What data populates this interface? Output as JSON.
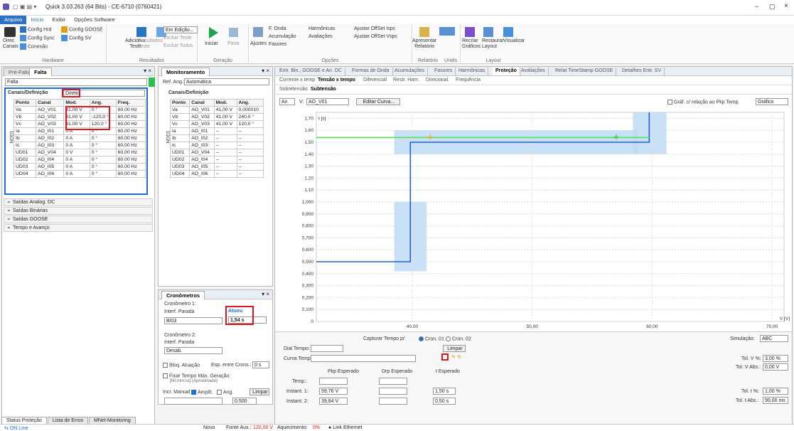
{
  "titlebar": {
    "title": "Quick 3.03.263 (64 Bits) - CE-6710 (0760421)",
    "min": "−",
    "max": "▢",
    "close": "×"
  },
  "menu": [
    "Arquivo",
    "Início",
    "Exibir",
    "Opções Software"
  ],
  "ribbon": {
    "direc": "Direc\nCanais",
    "config_hrd": "Config Hrd",
    "config_goose": "Config GOOSE",
    "config_sync": "Config Sync",
    "config_sv": "Config SV",
    "conexao": "Conexão",
    "hardware": "Hardware",
    "adicionar": "Adicionar\nTeste",
    "resultados_btn": "Resultados\nTeste",
    "em_edicao": "Em Edição...",
    "excluir_teste": "Excluir Teste",
    "excluir_todos": "Excluir Todos",
    "resultados": "Resultados",
    "iniciar": "Iniciar",
    "parar": "Parar",
    "geracao": "Geração",
    "ajustes": "Ajustes",
    "f_onda": "F. Onda",
    "acumulacao": "Acumulação",
    "fasores": "Fasores",
    "harmonicas": "Harmônicas",
    "avaliacoes": "Avaliações",
    "ajustar_offset_ispc": "Ajustar OffSet Ispc",
    "ajustar_offset_vspc": "Ajustar OffSet Vspc",
    "opcoes": "Opções",
    "apresentar": "Apresentar\nRelatório",
    "relatorio": "Relatório",
    "unids": "Unids",
    "recriar": "Recriar\nGráficos",
    "restaurar": "Restaurar\nLayout",
    "visualizar": "Visualizar",
    "layout": "Layout"
  },
  "left_panel": {
    "tabs": [
      "Pré-Falta",
      "Falta"
    ],
    "name_field": "Falta",
    "section": "Canais/Definição",
    "mode": "Direto",
    "side_label": "NOD1",
    "headers": [
      "Ponto",
      "Canal",
      "Mod.",
      "Ang.",
      "Freq."
    ],
    "rows": [
      [
        "Va",
        "AO_V01",
        "41,00 V",
        "0 °",
        "60,00 Hz"
      ],
      [
        "Vb",
        "AO_V02",
        "41,00 V",
        "-120,0 °",
        "60,00 Hz"
      ],
      [
        "Vc",
        "AO_V03",
        "41,00 V",
        "120,0 °",
        "60,00 Hz"
      ],
      [
        "Ia",
        "AO_I01",
        "0 A",
        "0 °",
        "60,00 Hz"
      ],
      [
        "Ib",
        "AO_I02",
        "0 A",
        "0 °",
        "60,00 Hz"
      ],
      [
        "Ic",
        "AO_I03",
        "0 A",
        "0 °",
        "60,00 Hz"
      ],
      [
        "UD01",
        "AO_V04",
        "0 V",
        "0 °",
        "60,00 Hz"
      ],
      [
        "UD02",
        "AO_I04",
        "0 A",
        "0 °",
        "60,00 Hz"
      ],
      [
        "UD03",
        "AO_I05",
        "0 A",
        "0 °",
        "60,00 Hz"
      ],
      [
        "UD04",
        "AO_I06",
        "0 A",
        "0 °",
        "60,00 Hz"
      ]
    ],
    "sections": [
      "Saídas Analog. DC",
      "Saídas Binárias",
      "Saídas GOOSE",
      "Tempo e Avanço"
    ]
  },
  "monitor": {
    "title": "Monitoramento",
    "ref_label": "Ref. Ang.:",
    "ref_value": "Automática",
    "section": "Canais/Definição",
    "side_label": "NOD1",
    "headers": [
      "Ponto",
      "Canal",
      "Mod.",
      "Ang."
    ],
    "rows": [
      [
        "Va",
        "AO_V01",
        "41,00 V",
        "0,000010"
      ],
      [
        "Vb",
        "AO_V02",
        "41,00 V",
        "240,0 °"
      ],
      [
        "Vc",
        "AO_V03",
        "41,00 V",
        "120,0 °"
      ],
      [
        "Ia",
        "AO_I01",
        "--",
        "--"
      ],
      [
        "Ib",
        "AO_I02",
        "--",
        "--"
      ],
      [
        "Ic",
        "AO_I03",
        "--",
        "--"
      ],
      [
        "UD01",
        "AO_V04",
        "--",
        "--"
      ],
      [
        "UD02",
        "AO_I04",
        "--",
        "--"
      ],
      [
        "UD03",
        "AO_I05",
        "--",
        "--"
      ],
      [
        "UD04",
        "AO_I06",
        "--",
        "--"
      ]
    ]
  },
  "crono": {
    "title": "Cronômetros",
    "c1": "Cronômetro 1:",
    "interf": "Interf. Parada",
    "c1_input": "BI03",
    "atuou": "Atuou",
    "time": "1,54 s",
    "c2": "Cronômetro 2:",
    "interf2": "Interf. Parada",
    "c2_input": "Desab.",
    "bloq": "Bloq. Atuação",
    "esp": "Esp. entre Crons.:",
    "esp_val": "0 s",
    "fixar": "Fixar Tempo Máx. Geração:",
    "fixar_sub": "[hh:mm:ss] (Aproximado)",
    "incr": "Incr. Manual",
    "amplit": "Amplit.",
    "ang": "Ang.",
    "limpar": "Limpar",
    "step": "0,500"
  },
  "right_tabs": [
    "Entr. Bin., GOOSE e An. DC",
    "Formas de Onda",
    "Acumulações",
    "Fasores",
    "Harmônicas",
    "Proteção",
    "Avaliações",
    "Relat TimeStamp GOOSE",
    "Detalhes Entr. SV"
  ],
  "prot_tabs": [
    "Corrente x tempo",
    "Tensão x tempo",
    "Diferencial",
    "Restr. Ham.",
    "Direcional",
    "Frequência"
  ],
  "sub_tabs": [
    "Sobretensão",
    "Subtensão"
  ],
  "chart_toolbar": {
    "an": "An",
    "v_label": "V:",
    "v_value": "AO_V01",
    "editar": "Editar Curva...",
    "grafico_chk": "Gráf. c/ relação ao Pkp Temp.",
    "grafico": "Gráfico"
  },
  "chart_data": {
    "type": "line",
    "xlabel": "V [V]",
    "ylabel": "t [s]",
    "xlim": [
      32,
      71
    ],
    "ylim": [
      0,
      1.75
    ],
    "y_ticks": [
      {
        "v": 0,
        "t": "0"
      },
      {
        "v": 0.1,
        "t": "0,100"
      },
      {
        "v": 0.2,
        "t": "0,200"
      },
      {
        "v": 0.3,
        "t": "0,300"
      },
      {
        "v": 0.4,
        "t": "0,400"
      },
      {
        "v": 0.5,
        "t": "0,500"
      },
      {
        "v": 0.6,
        "t": "0,600"
      },
      {
        "v": 0.7,
        "t": "0,700"
      },
      {
        "v": 0.8,
        "t": "0,800"
      },
      {
        "v": 0.9,
        "t": "0,900"
      },
      {
        "v": 1.0,
        "t": "1,000"
      },
      {
        "v": 1.1,
        "t": "1,10"
      },
      {
        "v": 1.2,
        "t": "1,20"
      },
      {
        "v": 1.3,
        "t": "1,30"
      },
      {
        "v": 1.4,
        "t": "1,40"
      },
      {
        "v": 1.5,
        "t": "1,50"
      },
      {
        "v": 1.6,
        "t": "1,60"
      },
      {
        "v": 1.7,
        "t": "1,70"
      }
    ],
    "x_ticks": [
      {
        "v": 40,
        "t": "40,00"
      },
      {
        "v": 50,
        "t": "50,00"
      },
      {
        "v": 60,
        "t": "60,00"
      },
      {
        "v": 70,
        "t": "70,00"
      }
    ],
    "series": [
      {
        "color": "#1f5fd6",
        "points": [
          [
            32,
            0.5
          ],
          [
            39.84,
            0.5
          ],
          [
            39.84,
            1.5
          ],
          [
            59.76,
            1.5
          ],
          [
            59.76,
            1.75
          ]
        ]
      },
      {
        "color": "#5adf5a",
        "points": [
          [
            32,
            1.54
          ],
          [
            59.76,
            1.54
          ]
        ]
      }
    ],
    "tolerance_bands": [
      {
        "x1": 38.5,
        "x2": 41.2,
        "y1": 0.42,
        "y2": 1.0
      },
      {
        "x1": 38.5,
        "x2": 58.8,
        "y1": 1.4,
        "y2": 1.6
      },
      {
        "x1": 58.4,
        "x2": 61.2,
        "y1": 1.4,
        "y2": 1.75
      }
    ],
    "markers": [
      {
        "x": 41.5,
        "y": 1.54,
        "color": "#f5a623"
      },
      {
        "x": 57.0,
        "y": 1.54,
        "color": "#3bbf3b"
      }
    ]
  },
  "bottom": {
    "capturar": "Capturar Tempo p/:",
    "cron01": "Cron. 01",
    "cron02": "Cron. 02",
    "limpar": "Limpar",
    "dial": "Dial Tempo:",
    "curva": "Curva Temp.:",
    "pkp": "Pkp Esperado",
    "drp": "Drp Esperado",
    "t_esp": "t Esperado",
    "temp": "Temp.:",
    "inst1": "Instant. 1:",
    "inst1_v": "59,76 V",
    "inst1_t": "1,50 s",
    "inst2": "Instant. 2:",
    "inst2_v": "39,84 V",
    "inst2_t": "0,50 s",
    "simul": "Simulação:",
    "simul_v": "ABC",
    "tolv": "Tol. V %:",
    "tolv_v": "3,00 %",
    "tolvabs": "Tol. V Abs.:",
    "tolvabs_v": "0,00 V",
    "tolt": "Tol. t %:",
    "tolt_v": "1,00 %",
    "toltabs": "Tol. t Abs.:",
    "toltabs_v": "90,00 ms"
  },
  "status_tabs": [
    "Status Proteção",
    "Lista de Erros",
    "MNet-Monitoring"
  ],
  "statusbar": {
    "online": "ON Line",
    "novo": "Novo",
    "fonte": "Fonte Aux.:",
    "fonte_v": "120,00 V",
    "aquec": "Aquecimento:",
    "aquec_v": "0%",
    "link": "Link Ethernet"
  }
}
